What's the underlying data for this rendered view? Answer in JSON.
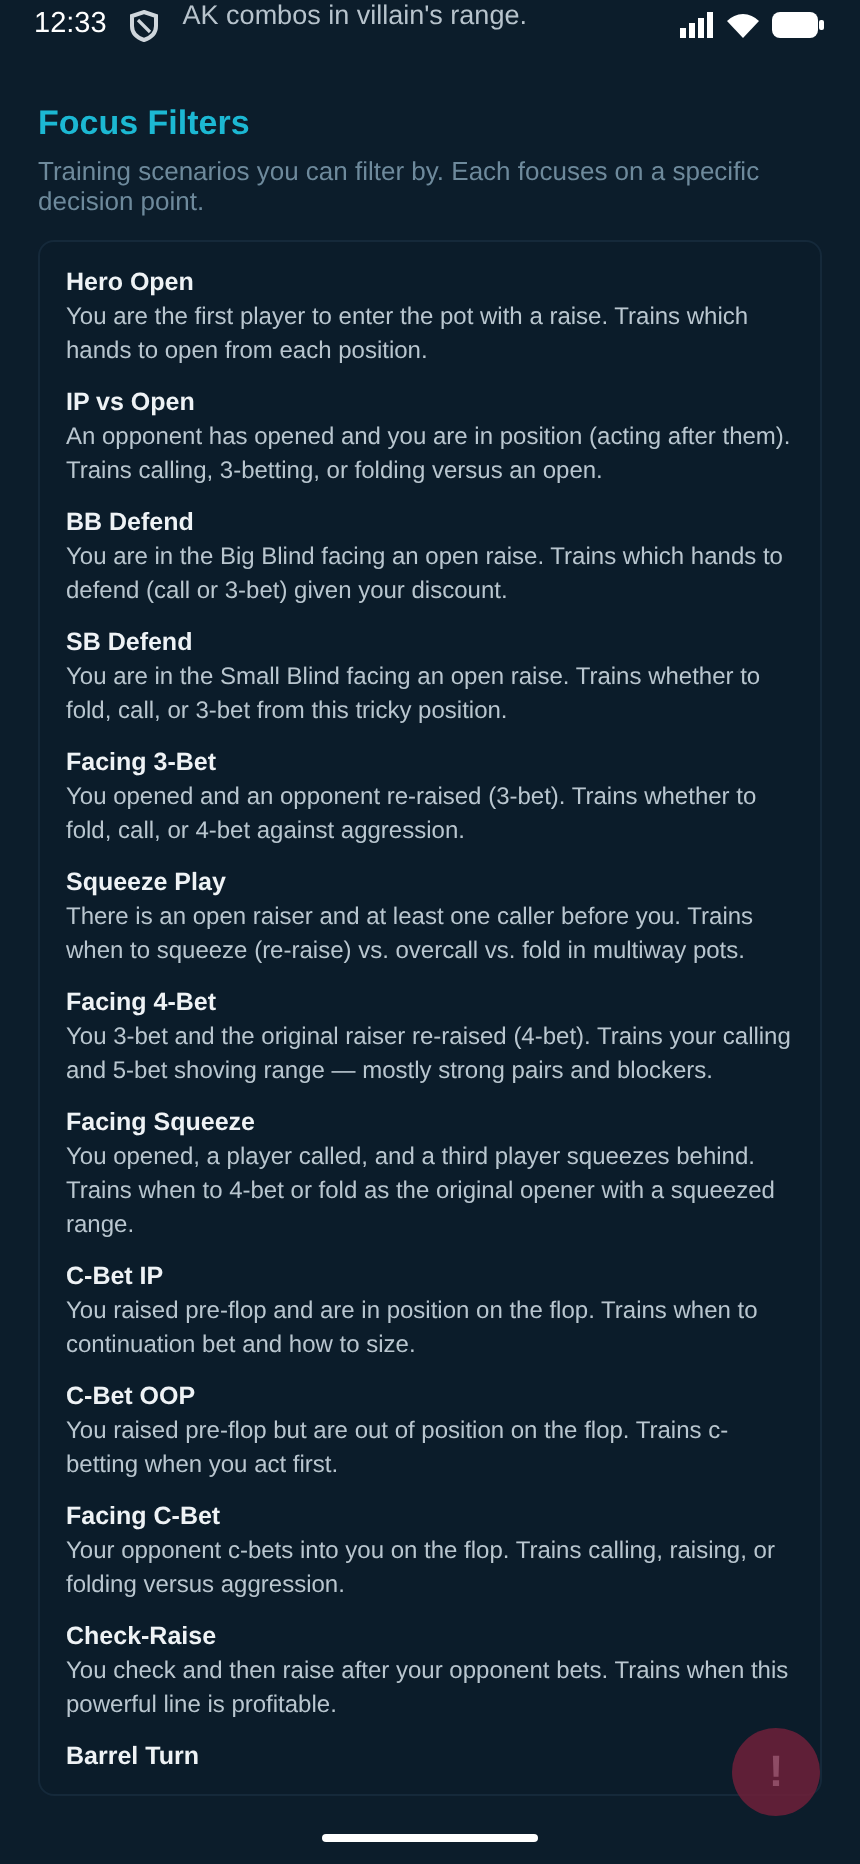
{
  "status_bar": {
    "time": "12:33",
    "overlay_text": "AK combos in villain's range."
  },
  "header": {
    "title": "Focus Filters",
    "subtitle": "Training scenarios you can filter by. Each focuses on a specific decision point."
  },
  "filters": [
    {
      "name": "Hero Open",
      "description": "You are the first player to enter the pot with a raise. Trains which hands to open from each position."
    },
    {
      "name": "IP vs Open",
      "description": "An opponent has opened and you are in position (acting after them). Trains calling, 3-betting, or folding versus an open."
    },
    {
      "name": "BB Defend",
      "description": "You are in the Big Blind facing an open raise. Trains which hands to defend (call or 3-bet) given your discount."
    },
    {
      "name": "SB Defend",
      "description": "You are in the Small Blind facing an open raise. Trains whether to fold, call, or 3-bet from this tricky position."
    },
    {
      "name": "Facing 3-Bet",
      "description": "You opened and an opponent re-raised (3-bet). Trains whether to fold, call, or 4-bet against aggression."
    },
    {
      "name": "Squeeze Play",
      "description": "There is an open raiser and at least one caller before you. Trains when to squeeze (re-raise) vs. overcall vs. fold in multiway pots."
    },
    {
      "name": "Facing 4-Bet",
      "description": "You 3-bet and the original raiser re-raised (4-bet). Trains your calling and 5-bet shoving range — mostly strong pairs and blockers."
    },
    {
      "name": "Facing Squeeze",
      "description": "You opened, a player called, and a third player squeezes behind. Trains when to 4-bet or fold as the original opener with a squeezed range."
    },
    {
      "name": "C-Bet IP",
      "description": "You raised pre-flop and are in position on the flop. Trains when to continuation bet and how to size."
    },
    {
      "name": "C-Bet OOP",
      "description": "You raised pre-flop but are out of position on the flop. Trains c-betting when you act first."
    },
    {
      "name": "Facing C-Bet",
      "description": "Your opponent c-bets into you on the flop. Trains calling, raising, or folding versus aggression."
    },
    {
      "name": "Check-Raise",
      "description": "You check and then raise after your opponent bets. Trains when this powerful line is profitable."
    },
    {
      "name": "Barrel Turn"
    }
  ],
  "fab": {
    "label": "!"
  }
}
